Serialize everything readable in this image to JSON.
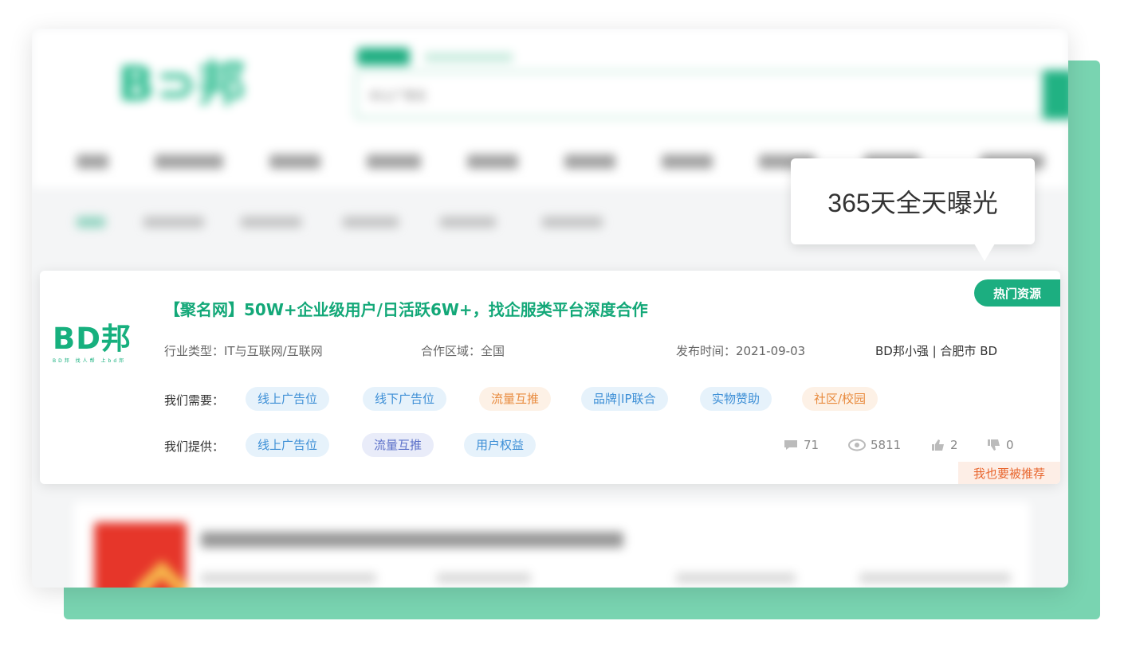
{
  "tooltip": {
    "text": "365天全天曝光"
  },
  "card": {
    "logo": {
      "text": "BD邦",
      "sub": "BD邦 找人帮 上bd邦"
    },
    "title": "【聚名网】50W+企业级用户/日活跃6W+，找企服类平台深度合作",
    "badge": "热门资源",
    "meta": {
      "industry": "行业类型：IT与互联网/互联网",
      "region": "合作区域：全国",
      "date": "发布时间：2021-09-03",
      "author": "BD邦小强 | 合肥市 BD"
    },
    "needs": {
      "label": "我们需要：",
      "tags": [
        {
          "text": "线上广告位",
          "tone": "blue"
        },
        {
          "text": "线下广告位",
          "tone": "blue"
        },
        {
          "text": "流量互推",
          "tone": "orange"
        },
        {
          "text": "品牌|IP联合",
          "tone": "blue"
        },
        {
          "text": "实物赞助",
          "tone": "blue"
        },
        {
          "text": "社区/校园",
          "tone": "orange"
        }
      ]
    },
    "offers": {
      "label": "我们提供：",
      "tags": [
        {
          "text": "线上广告位",
          "tone": "blue"
        },
        {
          "text": "流量互推",
          "tone": "indigo"
        },
        {
          "text": "用户权益",
          "tone": "blue"
        }
      ]
    },
    "stats": {
      "comments": "71",
      "views": "5811",
      "likes": "2",
      "dislikes": "0"
    },
    "recommend": "我也要被推荐"
  },
  "search": {
    "placeholder": "ID上广告位"
  },
  "colors": {
    "brand": "#1cae80",
    "accent_back": "#79d4b1"
  }
}
